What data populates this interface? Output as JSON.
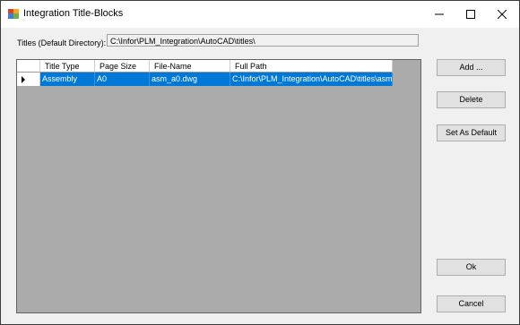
{
  "window": {
    "title": "Integration Title-Blocks"
  },
  "titles": {
    "label": "Titles (Default Directory):",
    "path": "C:\\Infor\\PLM_Integration\\AutoCAD\\titles\\"
  },
  "grid": {
    "columns": [
      "Title Type",
      "Page Size",
      "File-Name",
      "Full Path"
    ],
    "rows": [
      {
        "title_type": "Assembly",
        "page_size": "A0",
        "file_name": "asm_a0.dwg",
        "full_path": "C:\\Infor\\PLM_Integration\\AutoCAD\\titles\\asm_a0..."
      }
    ],
    "selected_color": "#0078d7",
    "background_color": "#ababab"
  },
  "buttons": {
    "add": "Add ...",
    "delete": "Delete",
    "set_default": "Set As Default",
    "ok": "Ok",
    "cancel": "Cancel"
  },
  "icons": {
    "app": "title-blocks-app-icon",
    "minimize": "minimize-icon",
    "maximize": "maximize-icon",
    "close": "close-icon",
    "row_pointer": "row-pointer-icon"
  }
}
